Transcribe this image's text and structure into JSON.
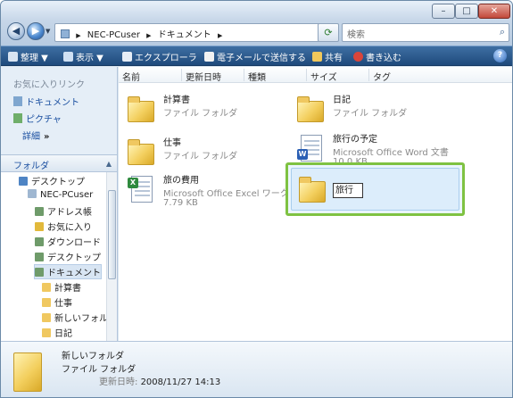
{
  "address": {
    "crumbs": [
      "NEC-PCuser",
      "ドキュメント"
    ]
  },
  "search": {
    "placeholder": "検索"
  },
  "toolbar": {
    "organize": "整理",
    "view": "表示",
    "explorer": "エクスプローラ",
    "email": "電子メールで送信する",
    "share": "共有",
    "burn": "書き込む"
  },
  "left": {
    "favorites_title": "お気に入りリンク",
    "favorites": [
      "ドキュメント",
      "ピクチャ"
    ],
    "detail": "詳細",
    "folders_title": "フォルダ",
    "tree": [
      "デスクトップ",
      "NEC-PCuser",
      "アドレス帳",
      "お気に入り",
      "ダウンロード",
      "デスクトップ",
      "ドキュメント",
      "計算書",
      "仕事",
      "新しいフォル",
      "日記"
    ]
  },
  "columns": [
    "名前",
    "更新日時",
    "種類",
    "サイズ",
    "タグ"
  ],
  "items": [
    {
      "name": "計算書",
      "type": "ファイル フォルダ",
      "size": ""
    },
    {
      "name": "日記",
      "type": "ファイル フォルダ",
      "size": ""
    },
    {
      "name": "仕事",
      "type": "ファイル フォルダ",
      "size": ""
    },
    {
      "name": "旅行の予定",
      "type": "Microsoft Office Word 文書",
      "size": "10.0 KB"
    },
    {
      "name": "旅の費用",
      "type": "Microsoft Office Excel ワーク...",
      "size": "7.79 KB"
    }
  ],
  "rename": {
    "value": "旅行"
  },
  "status": {
    "name": "新しいフォルダ",
    "type": "ファイル フォルダ",
    "date_label": "更新日時:",
    "date_value": "2008/11/27 14:13"
  },
  "colors": {
    "toolbar": "#1f4a7c",
    "highlight": "#7fc242",
    "link": "#1a4fa0"
  }
}
